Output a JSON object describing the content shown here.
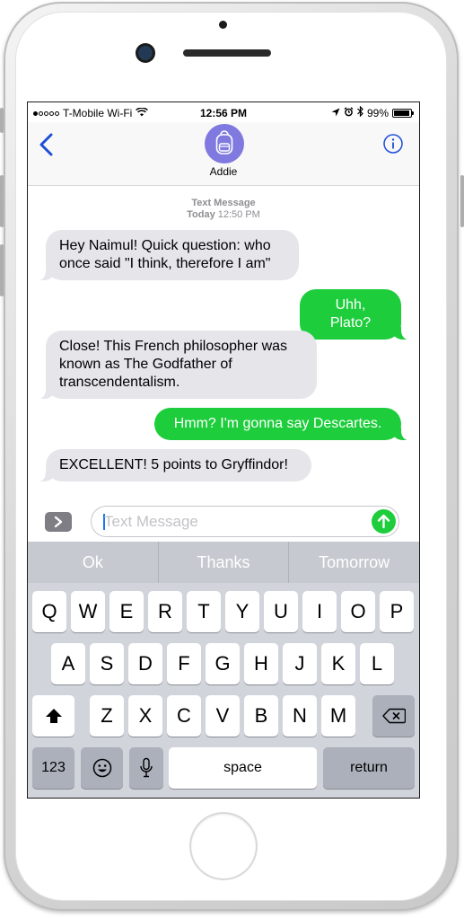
{
  "status_bar": {
    "carrier": "T-Mobile Wi-Fi",
    "time": "12:56 PM",
    "battery": "99%",
    "battery_level": 0.99,
    "icons": [
      "signal-dots-icon",
      "wifi-icon",
      "location-arrow-icon",
      "alarm-icon",
      "bluetooth-icon",
      "battery-icon"
    ]
  },
  "nav": {
    "back_icon": "chevron-left-icon",
    "contact_name": "Addie",
    "avatar_icon": "backpack-icon",
    "info_icon": "info-icon"
  },
  "conversation": {
    "service": "Text Message",
    "timestamp_day": "Today",
    "timestamp_time": "12:50 PM",
    "messages": [
      {
        "direction": "in",
        "text": "Hey Naimul! Quick question: who once said \"I think, therefore I am\""
      },
      {
        "direction": "out",
        "text": "Uhh, Plato?"
      },
      {
        "direction": "in",
        "text": "Close! This French philosopher was known as The Godfather of transcendentalism."
      },
      {
        "direction": "out",
        "text": "Hmm? I'm gonna say Descartes."
      },
      {
        "direction": "in",
        "text": "EXCELLENT! 5 points to Gryffindor!"
      }
    ]
  },
  "composer": {
    "apps_icon": "chevron-right-icon",
    "placeholder": "Text Message",
    "send_icon": "arrow-up-icon"
  },
  "keyboard": {
    "suggestions": [
      "Ok",
      "Thanks",
      "Tomorrow"
    ],
    "row1": [
      "Q",
      "W",
      "E",
      "R",
      "T",
      "Y",
      "U",
      "I",
      "O",
      "P"
    ],
    "row2": [
      "A",
      "S",
      "D",
      "F",
      "G",
      "H",
      "J",
      "K",
      "L"
    ],
    "row3": [
      "Z",
      "X",
      "C",
      "V",
      "B",
      "N",
      "M"
    ],
    "numbers_label": "123",
    "space_label": "space",
    "return_label": "return"
  },
  "colors": {
    "accent": "#1d4ed8",
    "outgoing_bubble": "#1dcd3c",
    "incoming_bubble": "#e5e5ea",
    "avatar": "#7f79e0"
  }
}
